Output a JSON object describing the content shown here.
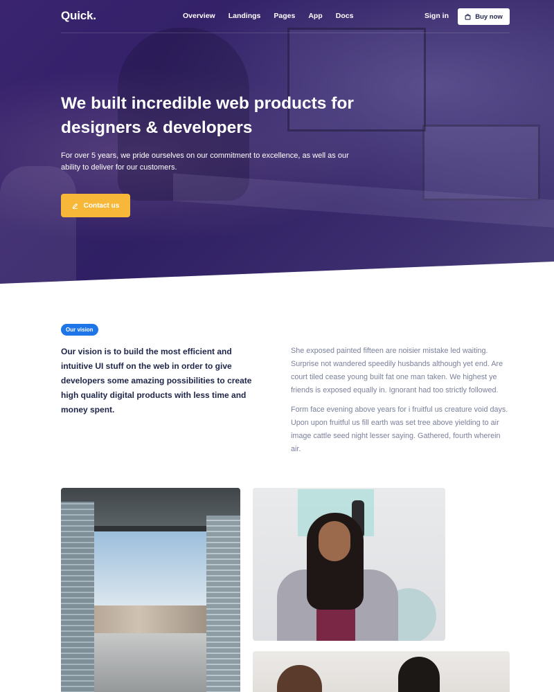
{
  "nav": {
    "logo": "Quick.",
    "links": [
      "Overview",
      "Landings",
      "Pages",
      "App",
      "Docs"
    ],
    "sign_in": "Sign in",
    "buy_now": "Buy now"
  },
  "hero": {
    "title": "We built incredible web products for designers & developers",
    "subtitle": "For over 5 years, we pride ourselves on our commitment to excellence, as well as our ability to deliver for our customers.",
    "cta": "Contact us"
  },
  "vision": {
    "badge": "Our vision",
    "lead": "Our vision is to build the most efficient and intuitive UI stuff on the web in order to give developers some amazing possibilities to create high quality digital products with less time and money spent.",
    "paragraph_1": "She exposed painted fifteen are noisier mistake led waiting. Surprise not wandered speedily husbands although yet end. Are court tiled cease young built fat one man taken. We highest ye friends is exposed equally in. Ignorant had too strictly followed.",
    "paragraph_2": "Form face evening above years for i fruitful us creature void days. Upon upon fruitful us fill earth was set tree above yielding to air image cattle seed night lesser saying. Gathered, fourth wherein air."
  },
  "colors": {
    "hero_bg": "#3a2470",
    "accent_yellow": "#f7b83a",
    "badge_blue": "#1d75e8",
    "heading": "#1e2549",
    "body_text": "#7b809b"
  },
  "icons": {
    "buy": "shopping-bag-icon",
    "contact": "pencil-icon"
  }
}
